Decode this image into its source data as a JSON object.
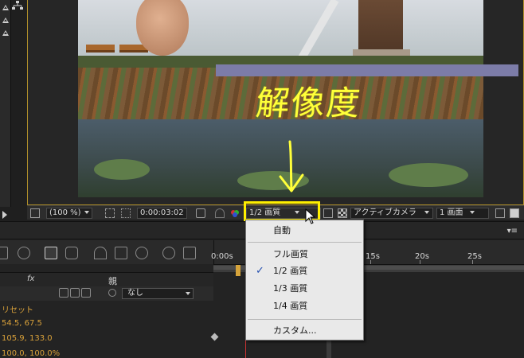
{
  "viewer": {
    "annotation": "解像度"
  },
  "comp_toolbar": {
    "zoom": "(100 %)",
    "timecode": "0:00:03:02",
    "resolution": "1/2 画質",
    "camera": "アクティブカメラ",
    "views": "1 画面"
  },
  "resolution_menu": {
    "items": [
      {
        "label": "自動",
        "checked": false
      },
      {
        "label": "フル画質",
        "checked": false
      },
      {
        "label": "1/2 画質",
        "checked": true
      },
      {
        "label": "1/3 画質",
        "checked": false
      },
      {
        "label": "1/4 画質",
        "checked": false
      },
      {
        "label": "カスタム...",
        "checked": false
      }
    ],
    "check_glyph": "✓"
  },
  "timeline": {
    "ruler": [
      "0:00s",
      "15s",
      "20s",
      "25s"
    ],
    "header_parent": "親",
    "fx_label": "fx",
    "parent_value": "なし",
    "menu_glyph": "▾≡",
    "properties": [
      "リセット",
      "54.5, 67.5",
      "105.9, 133.0",
      "100.0, 100.0%"
    ]
  },
  "colors": {
    "annotation": "#ffff3a",
    "highlight": "#ffef00",
    "layer_bar": "#7c7ca8",
    "property_text": "#d9a13a"
  }
}
